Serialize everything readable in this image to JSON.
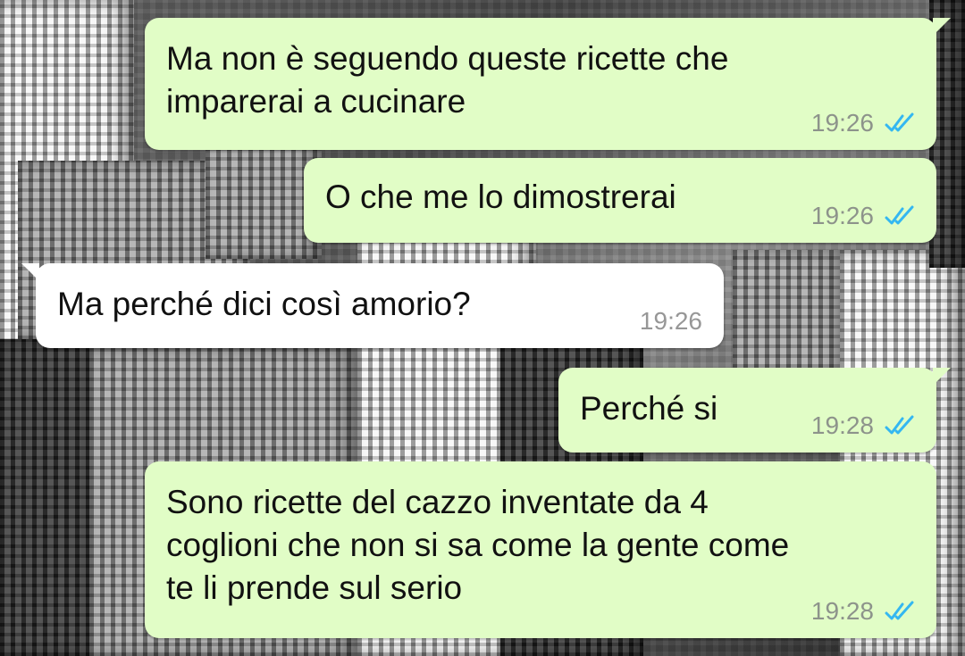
{
  "colors": {
    "outgoing_bubble": "#e1fdc6",
    "incoming_bubble": "#ffffff",
    "read_ticks": "#34b7f1",
    "timestamp": "#8d938b"
  },
  "messages": [
    {
      "direction": "out",
      "text": "Ma non è seguendo queste ricette che\nimparerai a cucinare",
      "time": "19:26",
      "status_icon": "double-check-read-icon"
    },
    {
      "direction": "out",
      "text": "O che me lo dimostrerai",
      "time": "19:26",
      "status_icon": "double-check-read-icon"
    },
    {
      "direction": "in",
      "text": "Ma perché dici così amorio?",
      "time": "19:26"
    },
    {
      "direction": "out",
      "text": "Perché si",
      "time": "19:28",
      "status_icon": "double-check-read-icon"
    },
    {
      "direction": "out",
      "text": "Sono ricette del cazzo inventate da 4\ncoglioni che non si sa come la gente come\nte li prende sul serio",
      "time": "19:28",
      "status_icon": "double-check-read-icon"
    }
  ]
}
